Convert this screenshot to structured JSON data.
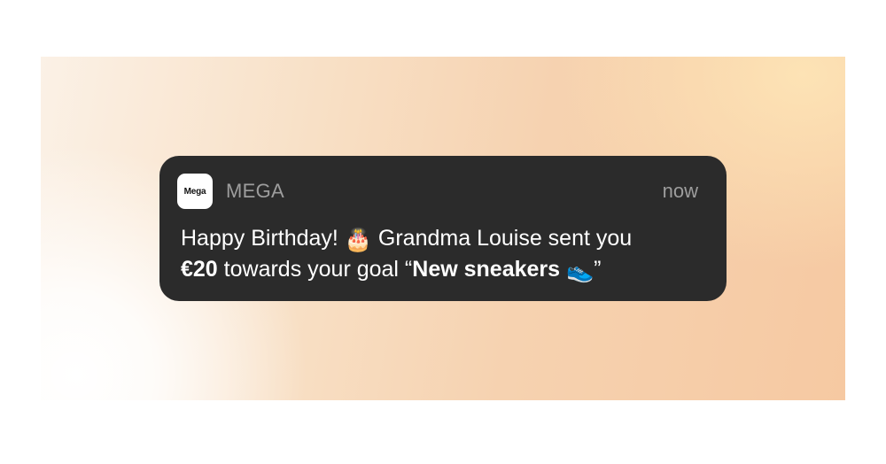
{
  "notification": {
    "app_icon_label": "Mega",
    "app_name": "MEGA",
    "time": "now",
    "message": {
      "part1": "Happy Birthday! ",
      "emoji_cake": "🎂",
      "part2": " Grandma Louise sent you",
      "amount": "€20",
      "part3": " towards your goal “",
      "goal_name": "New sneakers",
      "emoji_shoe": "👟",
      "part4": "”"
    }
  },
  "colors": {
    "card_background": "#2b2b2b",
    "muted_text": "#9d9d9d",
    "message_text": "#ffffff"
  }
}
